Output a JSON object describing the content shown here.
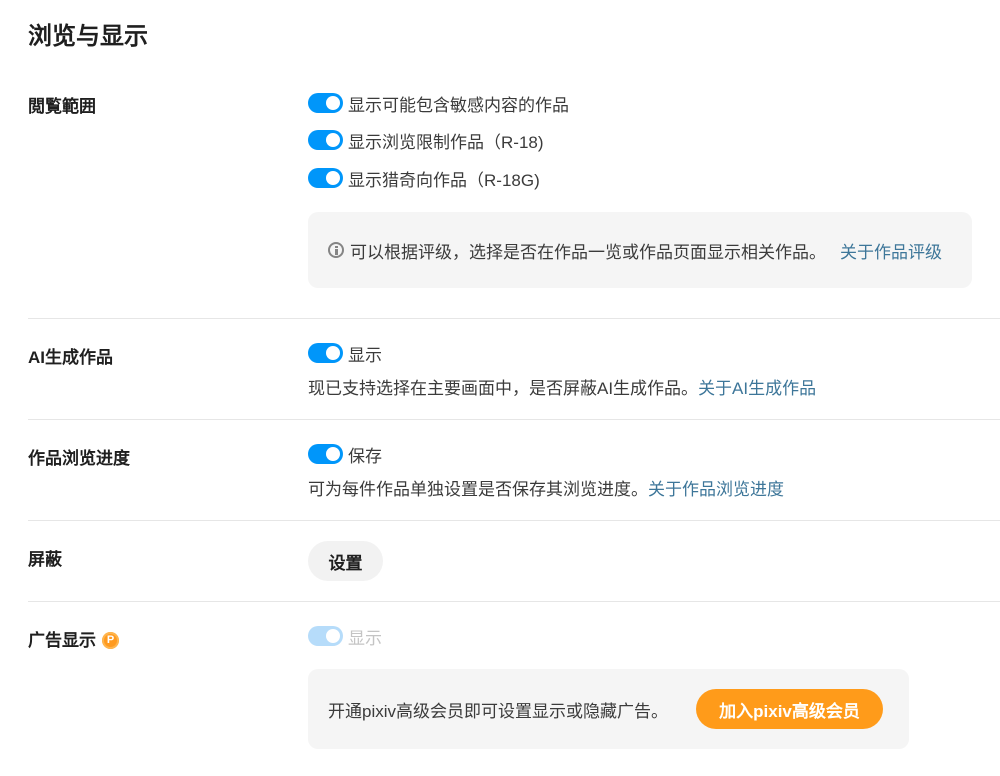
{
  "page_title": "浏览与显示",
  "range": {
    "label": "閲覧範囲",
    "options": [
      {
        "label": "显示可能包含敏感内容的作品",
        "enabled": true
      },
      {
        "label": "显示浏览限制作品（R-18)",
        "enabled": true
      },
      {
        "label": "显示猎奇向作品（R-18G)",
        "enabled": true
      }
    ],
    "info_text": "可以根据评级，选择是否在作品一览或作品页面显示相关作品。",
    "info_link": "关于作品评级"
  },
  "ai": {
    "label": "AI生成作品",
    "toggle_label": "显示",
    "enabled": true,
    "desc": "现已支持选择在主要画面中，是否屏蔽AI生成作品。",
    "link": "关于AI生成作品"
  },
  "progress": {
    "label": "作品浏览进度",
    "toggle_label": "保存",
    "enabled": true,
    "desc": "可为每件作品单独设置是否保存其浏览进度。",
    "link": "关于作品浏览进度"
  },
  "mute": {
    "label": "屏蔽",
    "button": "设置"
  },
  "ads": {
    "label": "广告显示",
    "badge": "P",
    "toggle_label": "显示",
    "enabled": true,
    "disabled": true,
    "box_text": "开通pixiv高级会员即可设置显示或隐藏广告。",
    "button": "加入pixiv高级会员"
  },
  "colors": {
    "toggle_on": "#0096fa",
    "toggle_disabled": "#b6dcfa",
    "link": "#3d7699",
    "premium": "#ff9b1a"
  }
}
